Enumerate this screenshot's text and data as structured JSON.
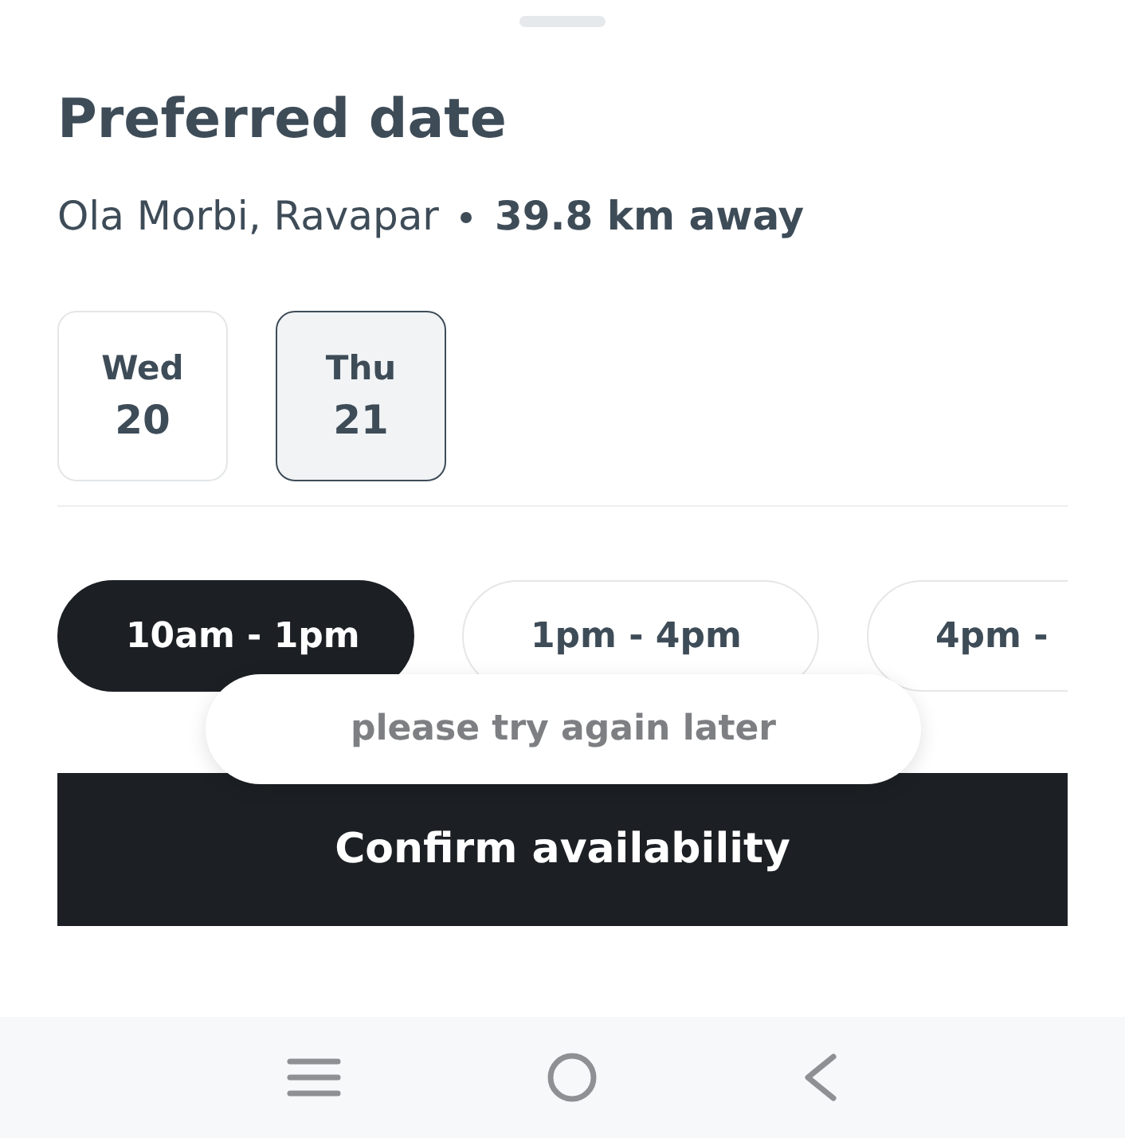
{
  "title": "Preferred date",
  "location": {
    "name": "Ola Morbi, Ravapar",
    "distance": "39.8 km away"
  },
  "dates": [
    {
      "weekday": "Wed",
      "day": "20",
      "selected": false
    },
    {
      "weekday": "Thu",
      "day": "21",
      "selected": true
    }
  ],
  "time_slots": [
    {
      "label": "10am - 1pm",
      "selected": true
    },
    {
      "label": "1pm - 4pm",
      "selected": false
    },
    {
      "label": "4pm -",
      "selected": false
    }
  ],
  "toast": "please try again later",
  "confirm_button": "Confirm availability"
}
